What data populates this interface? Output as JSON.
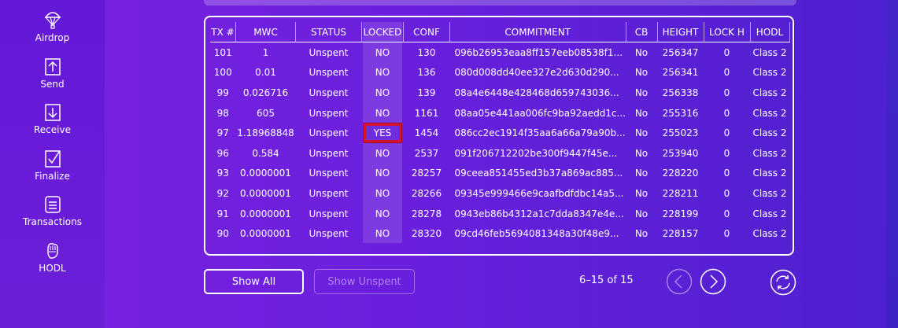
{
  "sidebar": {
    "items": [
      {
        "label": "Airdrop",
        "icon": "parachute-icon"
      },
      {
        "label": "Send",
        "icon": "arrow-up-box-icon"
      },
      {
        "label": "Receive",
        "icon": "arrow-down-box-icon"
      },
      {
        "label": "Finalize",
        "icon": "checkbox-icon"
      },
      {
        "label": "Transactions",
        "icon": "list-icon"
      },
      {
        "label": "HODL",
        "icon": "fist-icon"
      }
    ]
  },
  "table": {
    "columns": [
      "TX #",
      "MWC",
      "STATUS",
      "LOCKED",
      "CONF",
      "COMMITMENT",
      "CB",
      "HEIGHT",
      "LOCK H",
      "HODL"
    ],
    "rows": [
      [
        "101",
        "1",
        "Unspent",
        "NO",
        "130",
        "096b26953eaa8ff157eeb08538f1...",
        "No",
        "256347",
        "0",
        "Class 2"
      ],
      [
        "100",
        "0.01",
        "Unspent",
        "NO",
        "136",
        "080d008dd40ee327e2d630d290...",
        "No",
        "256341",
        "0",
        "Class 2"
      ],
      [
        "99",
        "0.026716",
        "Unspent",
        "NO",
        "139",
        "08a4e6448e428468d659743036...",
        "No",
        "256338",
        "0",
        "Class 2"
      ],
      [
        "98",
        "605",
        "Unspent",
        "NO",
        "1161",
        "08aa05e441aa006fc9ba92aedd1c...",
        "No",
        "255316",
        "0",
        "Class 2"
      ],
      [
        "97",
        "1.18968848",
        "Unspent",
        "YES",
        "1454",
        "086cc2ec1914f35aa6a66a79a90b...",
        "No",
        "255023",
        "0",
        "Class 2"
      ],
      [
        "96",
        "0.584",
        "Unspent",
        "NO",
        "2537",
        "091f206712202be300f9447f45e...",
        "No",
        "253940",
        "0",
        "Class 2"
      ],
      [
        "93",
        "0.0000001",
        "Unspent",
        "NO",
        "28257",
        "09ceea851455ed3b37a869ac885...",
        "No",
        "228220",
        "0",
        "Class 2"
      ],
      [
        "92",
        "0.0000001",
        "Unspent",
        "NO",
        "28266",
        "09345e999466e9caafbdfdbc14a5...",
        "No",
        "228211",
        "0",
        "Class 2"
      ],
      [
        "91",
        "0.0000001",
        "Unspent",
        "NO",
        "28278",
        "0943eb86b4312a1c7dda8347e4e...",
        "No",
        "228199",
        "0",
        "Class 2"
      ],
      [
        "90",
        "0.0000001",
        "Unspent",
        "NO",
        "28320",
        "09cd46feb5694081348a30f48e9...",
        "No",
        "228157",
        "0",
        "Class 2"
      ]
    ]
  },
  "buttons": {
    "show_all": "Show All",
    "show_unspent": "Show Unspent"
  },
  "pager": {
    "text": "6–15 of 15"
  },
  "colors": {
    "highlight": "#d4132e",
    "background": "#6a1fdc"
  }
}
